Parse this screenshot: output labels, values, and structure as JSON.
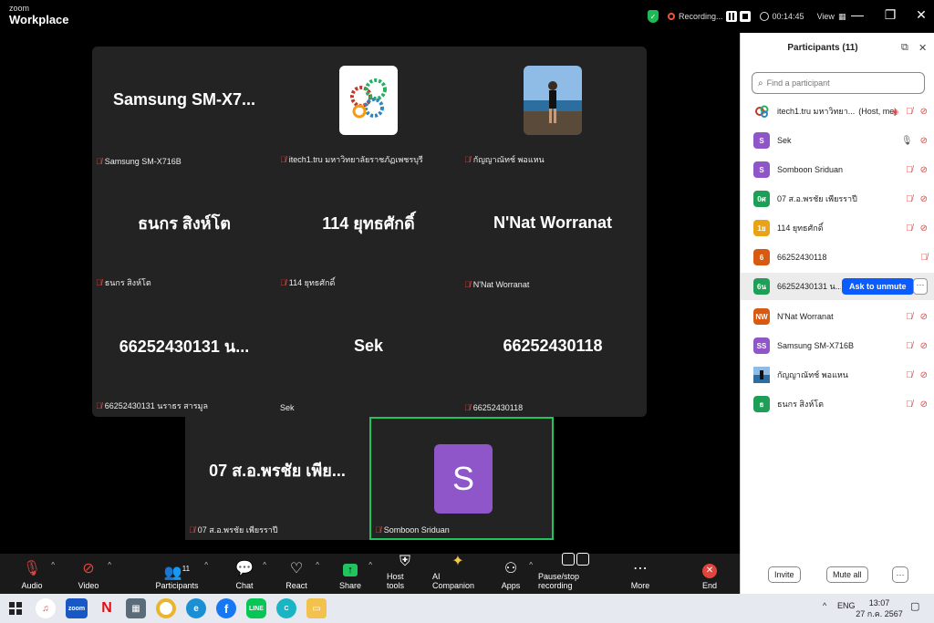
{
  "app": {
    "logo_top": "zoom",
    "logo_bottom": "Workplace"
  },
  "titlebar": {
    "recording_label": "Recording...",
    "timer": "00:14:45",
    "view_label": "View"
  },
  "gallery": {
    "tiles": [
      {
        "big": "Samsung  SM-X7...",
        "label": "Samsung SM-X716B"
      },
      {
        "big": "",
        "label": "itech1.tru มหาวิทยาลัยราชภัฏเพชรบุรี"
      },
      {
        "big": "",
        "label": "กัญญาณัทช์ พอแหน"
      },
      {
        "big": "ธนกร สิงห์โต",
        "label": "ธนกร สิงห์โต"
      },
      {
        "big": "114 ยุทธศักดิ์",
        "label": "114 ยุทธศักดิ์"
      },
      {
        "big": "N'Nat Worranat",
        "label": "N'Nat Worranat"
      },
      {
        "big": "66252430131 น...",
        "label": "66252430131 นราธร สารมูล"
      },
      {
        "big": "Sek",
        "label": "Sek"
      },
      {
        "big": "66252430118",
        "label": "66252430118"
      }
    ],
    "bottom_tiles": [
      {
        "big": "07 ส.อ.พรชัย เพีย...",
        "label": "07 ส.อ.พรชัย เพียรราปี"
      },
      {
        "avatar": "S",
        "label": "Somboon Sriduan"
      }
    ]
  },
  "toolbar": {
    "audio": "Audio",
    "video": "Video",
    "participants": "Participants",
    "participants_count": "11",
    "chat": "Chat",
    "react": "React",
    "share": "Share",
    "host_tools": "Host tools",
    "ai_companion": "AI Companion",
    "apps": "Apps",
    "pause_stop": "Pause/stop recording",
    "more": "More",
    "end": "End"
  },
  "panel": {
    "title": "Participants (11)",
    "search_placeholder": "Find a participant",
    "participants": [
      {
        "initials": "",
        "name": "itech1.tru มหาวิทยา...",
        "role": "(Host, me)",
        "color": "#ffffff"
      },
      {
        "initials": "S",
        "name": "Sek",
        "role": "",
        "color": "#8e56c8"
      },
      {
        "initials": "S",
        "name": "Somboon Sriduan",
        "role": "",
        "color": "#8e56c8"
      },
      {
        "initials": "0ศ",
        "name": "07 ส.อ.พรชัย เพียรราปี",
        "role": "",
        "color": "#1f9e58"
      },
      {
        "initials": "1ย",
        "name": "114 ยุทธศักดิ์",
        "role": "",
        "color": "#e8a317"
      },
      {
        "initials": "6",
        "name": "66252430118",
        "role": "",
        "color": "#d85a12"
      },
      {
        "initials": "6น",
        "name": "66252430131 น...",
        "role": "",
        "color": "#1f9e58"
      },
      {
        "initials": "NW",
        "name": "N'Nat Worranat",
        "role": "",
        "color": "#d85a12"
      },
      {
        "initials": "SS",
        "name": "Samsung SM-X716B",
        "role": "",
        "color": "#8e56c8"
      },
      {
        "initials": "",
        "name": "กัญญาณัทช์ พอแหน",
        "role": "",
        "color": "#4a7fb0"
      },
      {
        "initials": "ธ",
        "name": "ธนกร สิงห์โต",
        "role": "",
        "color": "#1f9e58"
      }
    ],
    "ask_to_unmute": "Ask to unmute",
    "more_glyph": "···",
    "invite": "Invite",
    "mute_all": "Mute all"
  },
  "taskbar": {
    "lang": "ENG",
    "time": "13:07",
    "date": "27 ก.ค. 2567"
  }
}
